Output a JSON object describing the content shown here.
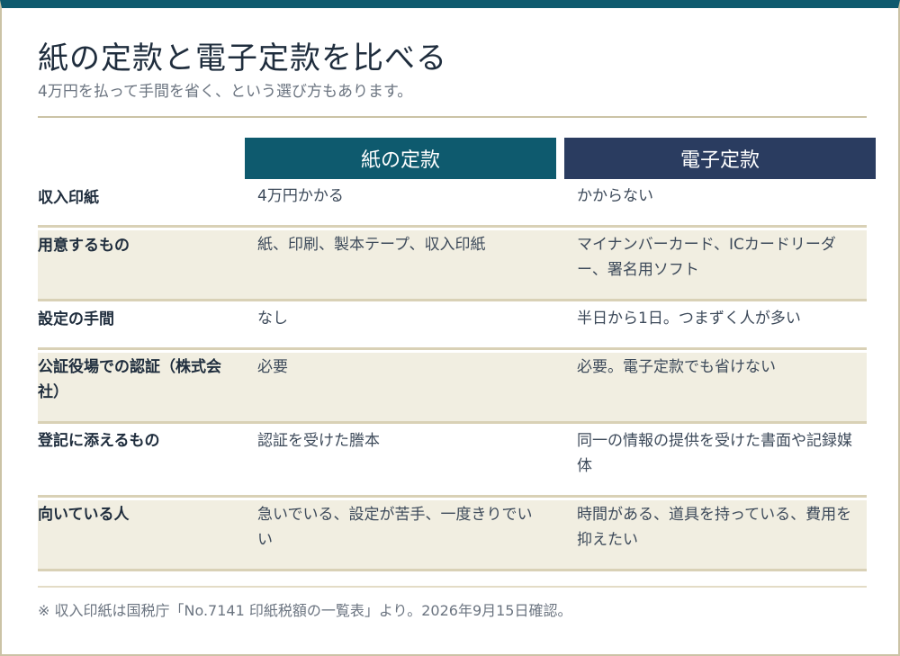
{
  "title": "紙の定款と電子定款を比べる",
  "subtitle": "4万円を払って手間を省く、という選び方もあります。",
  "columns": {
    "paper": "紙の定款",
    "digital": "電子定款"
  },
  "rows": [
    {
      "label": "収入印紙",
      "paper": "4万円かかる",
      "digital": "かからない"
    },
    {
      "label": "用意するもの",
      "paper": "紙、印刷、製本テープ、収入印紙",
      "digital": "マイナンバーカード、ICカードリーダー、署名用ソフト"
    },
    {
      "label": "設定の手間",
      "paper": "なし",
      "digital": "半日から1日。つまずく人が多い"
    },
    {
      "label": "公証役場での認証（株式会社）",
      "paper": "必要",
      "digital": "必要。電子定款でも省けない"
    },
    {
      "label": "登記に添えるもの",
      "paper": "認証を受けた謄本",
      "digital": "同一の情報の提供を受けた書面や記録媒体"
    },
    {
      "label": "向いている人",
      "paper": "急いでいる、設定が苦手、一度きりでいい",
      "digital": "時間がある、道具を持っている、費用を抑えたい"
    }
  ],
  "footnote": "※ 収入印紙は国税庁「No.7141 印紙税額の一覧表」より。2026年9月15日確認。",
  "colors": {
    "accent_teal": "#0e5a6e",
    "accent_navy": "#2a3c60",
    "row_alt_bg": "#f1eee1",
    "rule": "#cbc3a6"
  }
}
